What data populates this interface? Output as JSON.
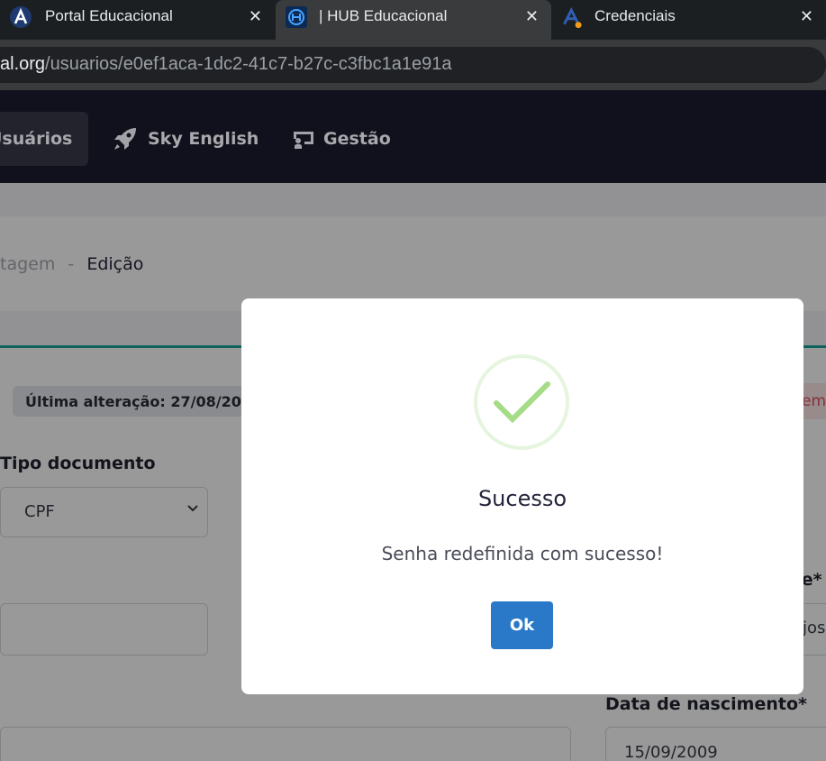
{
  "browser": {
    "tabs": [
      {
        "title": "Portal Educacional",
        "icon": "portal-logo-icon",
        "close": "✕"
      },
      {
        "title": "| HUB Educacional",
        "icon": "hub-logo-icon",
        "close": "✕"
      },
      {
        "title": "Credenciais",
        "icon": "credenciais-logo-icon",
        "close": "✕"
      }
    ],
    "url_host": "al.org",
    "url_path": "/usuarios/e0ef1aca-1dc2-41c7-b27c-c3fbc1a1e91a"
  },
  "nav": {
    "items": [
      {
        "label": "Usuários",
        "icon": "users-icon"
      },
      {
        "label": "Sky English",
        "icon": "rocket-icon"
      },
      {
        "label": "Gestão",
        "icon": "chalkboard-icon"
      }
    ]
  },
  "breadcrumb": {
    "prev": "tagem",
    "separator": "-",
    "current": "Edição"
  },
  "form": {
    "last_change": "Última alteração: 27/08/20",
    "red_tag": "emo",
    "doc_type_label": "Tipo documento",
    "doc_type_value": "CPF",
    "name_label": "me*",
    "name_value": "jos",
    "birth_label": "Data de nascimento*",
    "birth_value": "15/09/2009"
  },
  "modal": {
    "title": "Sucesso",
    "message": "Senha redefinida com sucesso!",
    "ok_label": "Ok",
    "icon": "success-check-icon"
  },
  "colors": {
    "accent": "#2a79c9",
    "teal": "#17a398",
    "success": "#a5dc86",
    "nav_bg": "#161626"
  }
}
